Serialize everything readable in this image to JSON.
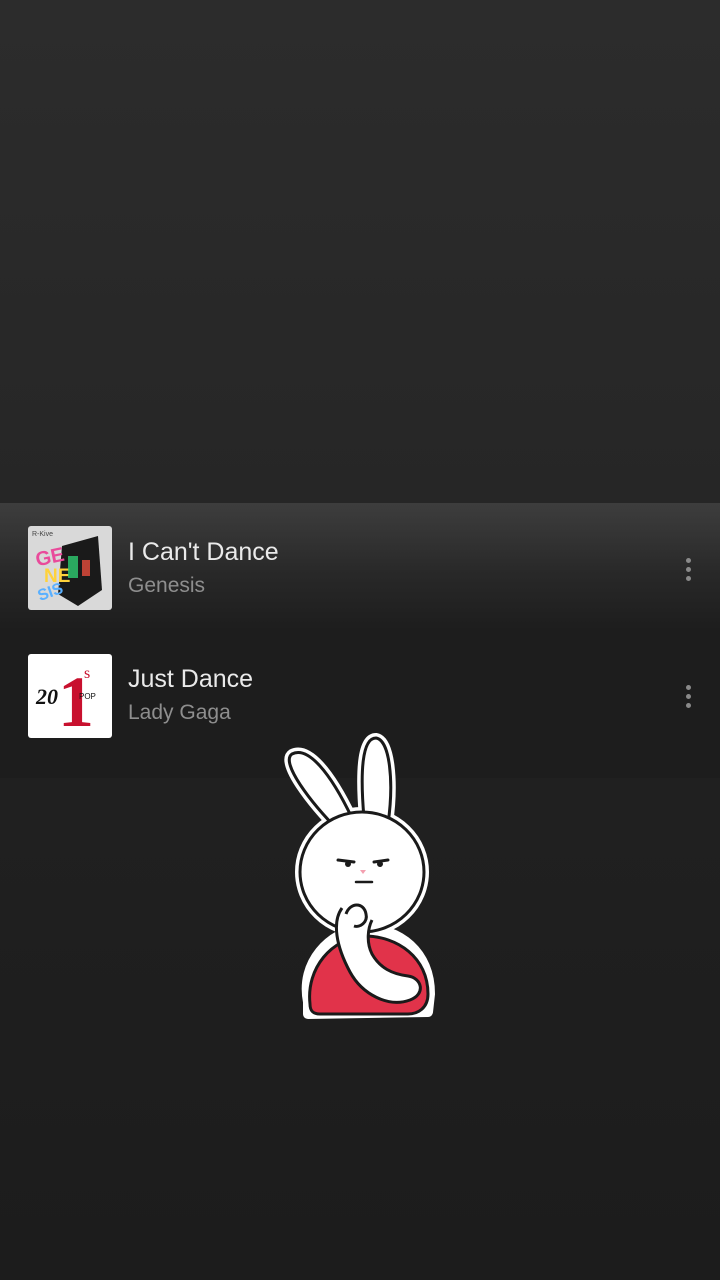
{
  "songs": [
    {
      "title": "I Can't Dance",
      "artist": "Genesis",
      "artwork": "genesis-album-art",
      "more_icon": "more-vertical-icon"
    },
    {
      "title": "Just Dance",
      "artist": "Lady Gaga",
      "artwork": "20s-number-ones-pop-album-art",
      "more_icon": "more-vertical-icon"
    }
  ],
  "artwork_text": {
    "genesis": {
      "label": "R-Kive",
      "letters": [
        "GE",
        "NE",
        "SIS"
      ]
    },
    "pop": {
      "big": "1",
      "sup": "s",
      "num": "20",
      "tag": "POP"
    }
  },
  "sticker": "thinking-bunny-sticker",
  "colors": {
    "background": "#262626",
    "panel": "#1d1d1d",
    "title": "#eaeaea",
    "artist": "#8e8e8e",
    "sticker_shirt": "#e1334a"
  }
}
